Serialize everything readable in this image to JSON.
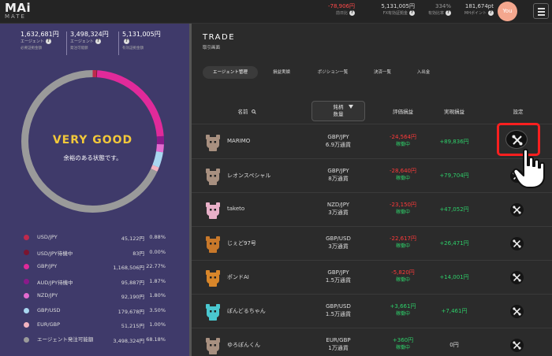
{
  "header": {
    "logo_main": "MAi",
    "logo_sub": "MATE",
    "stats": [
      {
        "value": "-78,906円",
        "label": "前日比",
        "tone": "red"
      },
      {
        "value": "5,131,005円",
        "label": "FX有効証拠金",
        "tone": "normal"
      },
      {
        "value": "334%",
        "label": "有効比率",
        "tone": "dim"
      },
      {
        "value": "181,674pt",
        "label": "MHポイント",
        "tone": "normal"
      }
    ],
    "avatar_label": "You",
    "menu_icon": "hamburger-icon"
  },
  "summary": [
    {
      "value": "1,632,681円",
      "label": "エージェント",
      "sub": "必要証拠金額"
    },
    {
      "value": "3,498,324円",
      "label": "エージェント",
      "sub": "発注可能額"
    },
    {
      "value": "5,131,005円",
      "label": "",
      "sub": "有効証拠金額"
    }
  ],
  "status": {
    "title": "VERY GOOD",
    "subtitle": "余裕のある状態です。"
  },
  "allocation": [
    {
      "name": "USD/JPY",
      "amount": "45,122円",
      "pct": "0.88%",
      "color": "#c0294c",
      "share": 0.88
    },
    {
      "name": "USD/JPY待機中",
      "amount": "83円",
      "pct": "0.00%",
      "color": "#7a1530",
      "share": 0.0
    },
    {
      "name": "GBP/JPY",
      "amount": "1,168,506円",
      "pct": "22.77%",
      "color": "#e02a9a",
      "share": 22.77
    },
    {
      "name": "AUD/JPY待機中",
      "amount": "95,887円",
      "pct": "1.87%",
      "color": "#8a1a8a",
      "share": 1.87
    },
    {
      "name": "NZD/JPY",
      "amount": "92,190円",
      "pct": "1.80%",
      "color": "#e46bd0",
      "share": 1.8
    },
    {
      "name": "GBP/USD",
      "amount": "179,678円",
      "pct": "3.50%",
      "color": "#a9d7f0",
      "share": 3.5
    },
    {
      "name": "EUR/GBP",
      "amount": "51,215円",
      "pct": "1.00%",
      "color": "#f2b3c0",
      "share": 1.0
    },
    {
      "name": "エージェント発注可能額",
      "amount": "3,498,324円",
      "pct": "68.18%",
      "color": "#9a9a9a",
      "share": 68.18
    }
  ],
  "trade": {
    "title": "TRADE",
    "subtitle": "取引画面",
    "tabs": [
      "エージェント管理",
      "損益実績",
      "ポジション一覧",
      "決済一覧",
      "入出金"
    ],
    "columns": {
      "name": "名前",
      "pair_line1": "銘柄",
      "pair_line2": "数量",
      "eval": "評価損益",
      "realized": "実現損益",
      "settings": "設定"
    },
    "rows": [
      {
        "name": "MARIMO",
        "pair": "GBP/JPY",
        "qty": "6.9万通貨",
        "eval": "-24,564円",
        "eval_sign": "neg",
        "status": "稼働中",
        "realized": "+89,836円",
        "pet_color": "#a89080"
      },
      {
        "name": "レオンスペシャル",
        "pair": "GBP/JPY",
        "qty": "8万通貨",
        "eval": "-28,640円",
        "eval_sign": "neg",
        "status": "稼働中",
        "realized": "+79,704円",
        "pet_color": "#a89080"
      },
      {
        "name": "taketo",
        "pair": "NZD/JPY",
        "qty": "3万通貨",
        "eval": "-23,150円",
        "eval_sign": "neg",
        "status": "稼働中",
        "realized": "+47,052円",
        "pet_color": "#e8b0c8"
      },
      {
        "name": "じぇど97号",
        "pair": "GBP/USD",
        "qty": "3万通貨",
        "eval": "-22,617円",
        "eval_sign": "neg",
        "status": "稼働中",
        "realized": "+26,471円",
        "pet_color": "#c8782a"
      },
      {
        "name": "ポンドAI",
        "pair": "GBP/JPY",
        "qty": "1.5万通貨",
        "eval": "-5,820円",
        "eval_sign": "neg",
        "status": "稼働中",
        "realized": "+14,001円",
        "pet_color": "#d8862a"
      },
      {
        "name": "ぽんどるちゃん",
        "pair": "GBP/USD",
        "qty": "1.5万通貨",
        "eval": "+3,661円",
        "eval_sign": "pos",
        "status": "稼働中",
        "realized": "+7,461円",
        "pet_color": "#4ac8d0"
      },
      {
        "name": "ゆろぽんくん",
        "pair": "EUR/GBP",
        "qty": "1万通貨",
        "eval": "+360円",
        "eval_sign": "pos",
        "status": "稼働中",
        "realized": "0円",
        "pet_color": "#a89080"
      }
    ]
  }
}
